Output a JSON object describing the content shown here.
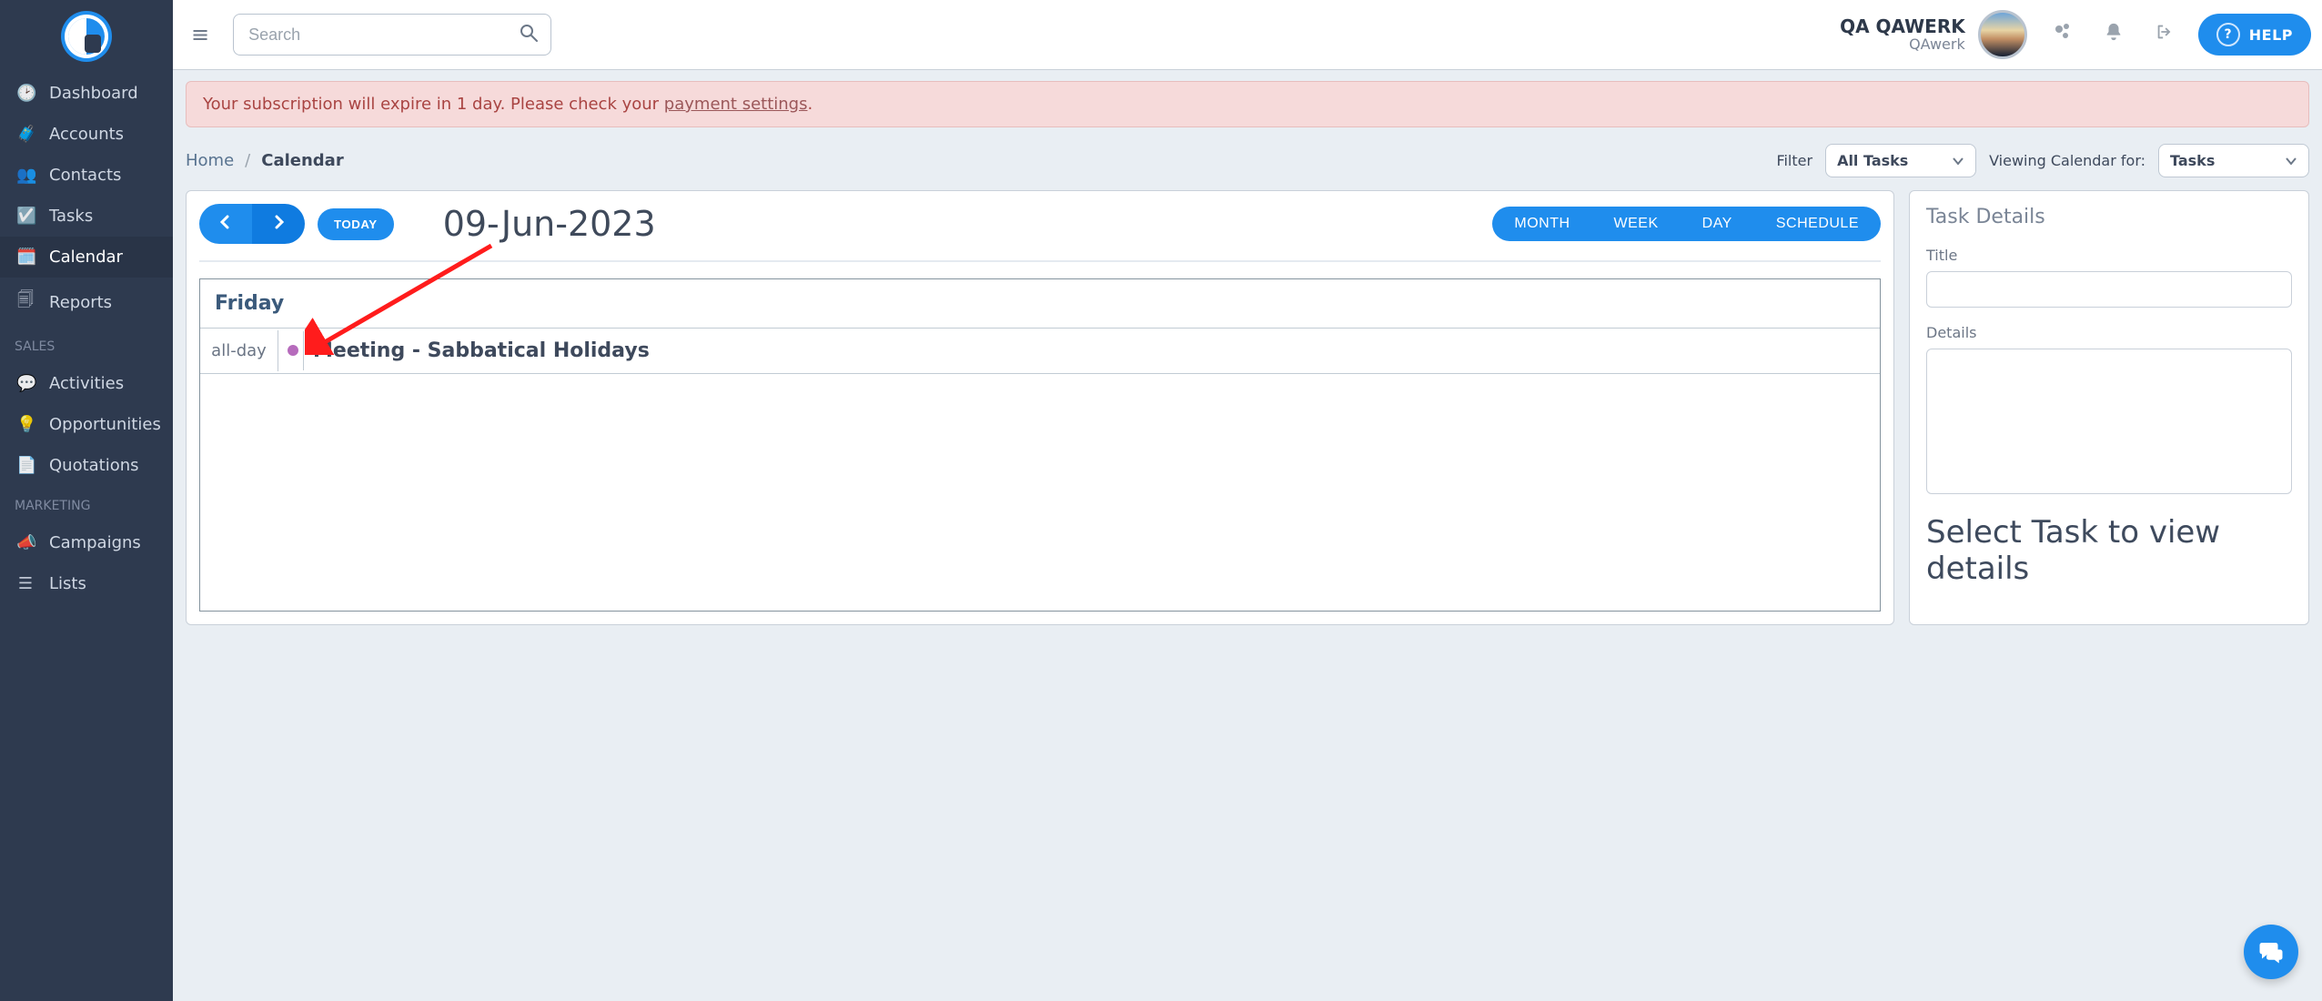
{
  "header": {
    "search_placeholder": "Search",
    "user_name": "QA QAWERK",
    "user_org": "QAwerk",
    "help_label": "HELP"
  },
  "sidebar": {
    "items": [
      {
        "icon": "dashboard",
        "label": "Dashboard",
        "active": false
      },
      {
        "icon": "accounts",
        "label": "Accounts",
        "active": false
      },
      {
        "icon": "contacts",
        "label": "Contacts",
        "active": false
      },
      {
        "icon": "tasks",
        "label": "Tasks",
        "active": false
      },
      {
        "icon": "calendar",
        "label": "Calendar",
        "active": true
      },
      {
        "icon": "reports",
        "label": "Reports",
        "active": false
      }
    ],
    "sales_heading": "SALES",
    "sales": [
      {
        "icon": "activities",
        "label": "Activities"
      },
      {
        "icon": "oppty",
        "label": "Opportunities"
      },
      {
        "icon": "quote",
        "label": "Quotations"
      }
    ],
    "marketing_heading": "MARKETING",
    "marketing": [
      {
        "icon": "campaigns",
        "label": "Campaigns"
      },
      {
        "icon": "lists",
        "label": "Lists"
      }
    ]
  },
  "alert": {
    "prefix": "Your subscription will expire in 1 day. Please check your ",
    "link_text": "payment settings",
    "suffix": "."
  },
  "crumbs": {
    "home": "Home",
    "sep": "/",
    "current": "Calendar"
  },
  "filters": {
    "filter_label": "Filter",
    "filter_value": "All Tasks",
    "viewing_label": "Viewing Calendar for:",
    "viewing_value": "Tasks"
  },
  "calendar": {
    "today": "TODAY",
    "date": "09-Jun-2023",
    "views": [
      "MONTH",
      "WEEK",
      "DAY",
      "SCHEDULE"
    ],
    "active_view": "DAY",
    "day_name": "Friday",
    "all_day_label": "all-day",
    "event_title": "Meeting - Sabbatical Holidays"
  },
  "details": {
    "heading": "Task Details",
    "title_label": "Title",
    "details_label": "Details",
    "placeholder": "Select Task to view details"
  }
}
